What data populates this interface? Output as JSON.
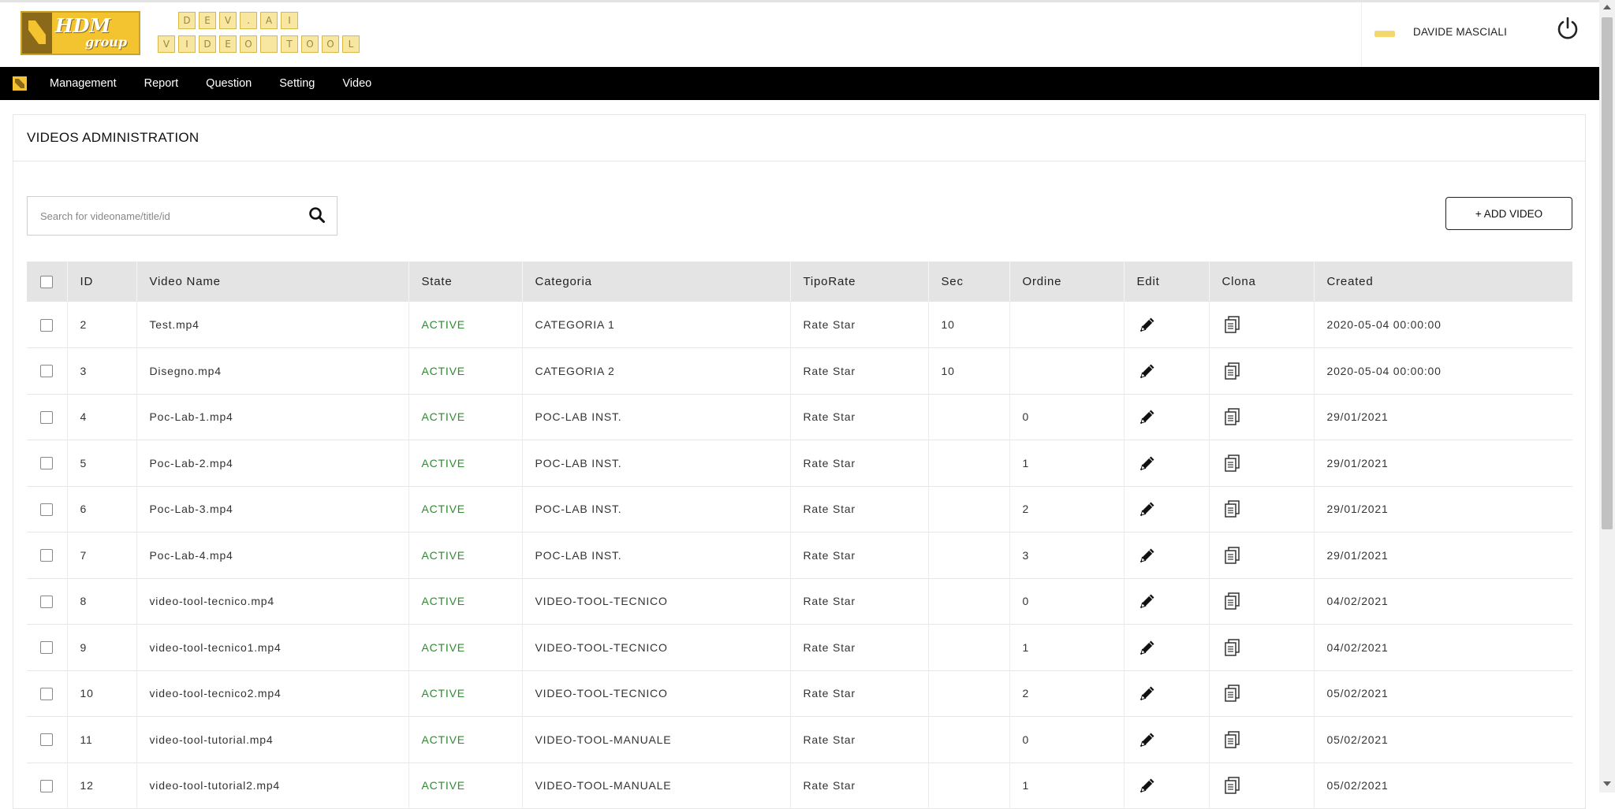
{
  "brand": {
    "logo_text_top": "HDM",
    "logo_text_bottom": "group",
    "dev_logo_row1": [
      "D",
      "E",
      "V",
      ".",
      "A",
      "I"
    ],
    "dev_logo_row2": [
      "V",
      "I",
      "D",
      "E",
      "O",
      "",
      "T",
      "O",
      "O",
      "L"
    ]
  },
  "header": {
    "user_name": "DAVIDE MASCIALI"
  },
  "nav": {
    "items": [
      "Management",
      "Report",
      "Question",
      "Setting",
      "Video"
    ]
  },
  "page": {
    "title": "VIDEOS ADMINISTRATION",
    "search_placeholder": "Search for videoname/title/id",
    "add_button": "+ ADD VIDEO"
  },
  "table": {
    "columns": [
      "ID",
      "Video Name",
      "State",
      "Categoria",
      "TipoRate",
      "Sec",
      "Ordine",
      "Edit",
      "Clona",
      "Created"
    ],
    "rows": [
      {
        "id": "2",
        "name": "Test.mp4",
        "state": "ACTIVE",
        "categoria": "CATEGORIA 1",
        "tiporate": "Rate Star",
        "sec": "10",
        "ordine": "",
        "created": "2020-05-04 00:00:00"
      },
      {
        "id": "3",
        "name": "Disegno.mp4",
        "state": "ACTIVE",
        "categoria": "CATEGORIA 2",
        "tiporate": "Rate Star",
        "sec": "10",
        "ordine": "",
        "created": "2020-05-04 00:00:00"
      },
      {
        "id": "4",
        "name": "Poc-Lab-1.mp4",
        "state": "ACTIVE",
        "categoria": "POC-LAB INST.",
        "tiporate": "Rate Star",
        "sec": "",
        "ordine": "0",
        "created": "29/01/2021"
      },
      {
        "id": "5",
        "name": "Poc-Lab-2.mp4",
        "state": "ACTIVE",
        "categoria": "POC-LAB INST.",
        "tiporate": "Rate Star",
        "sec": "",
        "ordine": "1",
        "created": "29/01/2021"
      },
      {
        "id": "6",
        "name": "Poc-Lab-3.mp4",
        "state": "ACTIVE",
        "categoria": "POC-LAB INST.",
        "tiporate": "Rate Star",
        "sec": "",
        "ordine": "2",
        "created": "29/01/2021"
      },
      {
        "id": "7",
        "name": "Poc-Lab-4.mp4",
        "state": "ACTIVE",
        "categoria": "POC-LAB INST.",
        "tiporate": "Rate Star",
        "sec": "",
        "ordine": "3",
        "created": "29/01/2021"
      },
      {
        "id": "8",
        "name": "video-tool-tecnico.mp4",
        "state": "ACTIVE",
        "categoria": "VIDEO-TOOL-TECNICO",
        "tiporate": "Rate Star",
        "sec": "",
        "ordine": "0",
        "created": "04/02/2021"
      },
      {
        "id": "9",
        "name": "video-tool-tecnico1.mp4",
        "state": "ACTIVE",
        "categoria": "VIDEO-TOOL-TECNICO",
        "tiporate": "Rate Star",
        "sec": "",
        "ordine": "1",
        "created": "04/02/2021"
      },
      {
        "id": "10",
        "name": "video-tool-tecnico2.mp4",
        "state": "ACTIVE",
        "categoria": "VIDEO-TOOL-TECNICO",
        "tiporate": "Rate Star",
        "sec": "",
        "ordine": "2",
        "created": "05/02/2021"
      },
      {
        "id": "11",
        "name": "video-tool-tutorial.mp4",
        "state": "ACTIVE",
        "categoria": "VIDEO-TOOL-MANUALE",
        "tiporate": "Rate Star",
        "sec": "",
        "ordine": "0",
        "created": "05/02/2021"
      },
      {
        "id": "12",
        "name": "video-tool-tutorial2.mp4",
        "state": "ACTIVE",
        "categoria": "VIDEO-TOOL-MANUALE",
        "tiporate": "Rate Star",
        "sec": "",
        "ordine": "1",
        "created": "05/02/2021"
      }
    ]
  },
  "colors": {
    "nav_bg": "#000000",
    "state_active": "#2e8b2e",
    "header_row_bg": "#e4e4e4",
    "brand_yellow": "#f4c430"
  },
  "icons": {
    "edit": "pencil-icon",
    "clone": "copy-icon",
    "search": "search-icon",
    "power": "power-icon"
  }
}
